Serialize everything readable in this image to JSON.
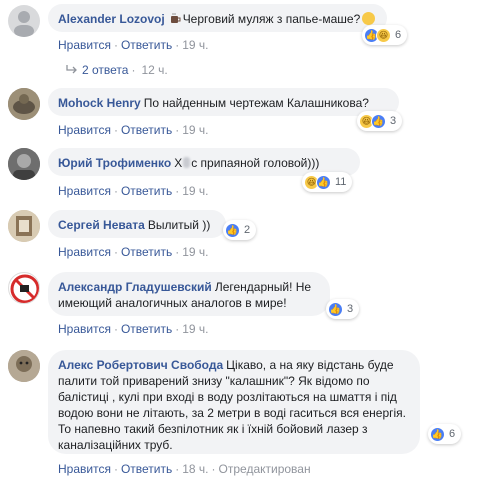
{
  "comments": [
    {
      "author": "Alexander Lozovoj",
      "text_before": "",
      "text": "Черговий муляж з папье-маше?",
      "like_label": "Нравится",
      "reply_label": "Ответить",
      "time": "19 ч.",
      "reactions": [
        "like",
        "haha"
      ],
      "reaction_count": "6"
    },
    {
      "author": "Mohock Henry",
      "text": "По найденным чертежам Калашникова?",
      "like_label": "Нравится",
      "reply_label": "Ответить",
      "time": "19 ч.",
      "reactions": [
        "haha",
        "like"
      ],
      "reaction_count": "3"
    },
    {
      "author": "Юрий Трофименко",
      "text_before": "Х",
      "text": "с припаяной головой)))",
      "like_label": "Нравится",
      "reply_label": "Ответить",
      "time": "19 ч.",
      "reactions": [
        "haha",
        "like"
      ],
      "reaction_count": "11"
    },
    {
      "author": "Сергей Невата",
      "text": "Вылитый ))",
      "like_label": "Нравится",
      "reply_label": "Ответить",
      "time": "19 ч.",
      "reactions": [
        "like"
      ],
      "reaction_count": "2"
    },
    {
      "author": "Александр Гладушевский",
      "text": "Легендарный! Не имеющий аналогичных аналогов в мире!",
      "like_label": "Нравится",
      "reply_label": "Ответить",
      "time": "19 ч.",
      "reactions": [
        "like"
      ],
      "reaction_count": "3"
    },
    {
      "author": "Алекс Робертович Свобода",
      "text": "Цікаво, а на яку відстань буде палити той приварений знизу \"калашник\"? Як відомо по балістиці , кулі при вході в воду розлітаються на шмаття і під водою вони не літають, за 2 метри в воді гаситься вся енергія. То напевно такий безпілотник як і їхній бойовий лазер з каналізаційних труб.",
      "like_label": "Нравится",
      "reply_label": "Ответить",
      "time": "18 ч.",
      "edited_label": "Отредактирован",
      "reactions": [
        "like"
      ],
      "reaction_count": "6"
    }
  ],
  "replies_link": {
    "label": "2 ответа",
    "time": "12 ч."
  },
  "colors": {
    "link": "#385898",
    "bubble": "#f2f3f5",
    "meta": "#90949c",
    "like_blue": "#4a7ef5",
    "emoji_yellow": "#f7c948"
  }
}
